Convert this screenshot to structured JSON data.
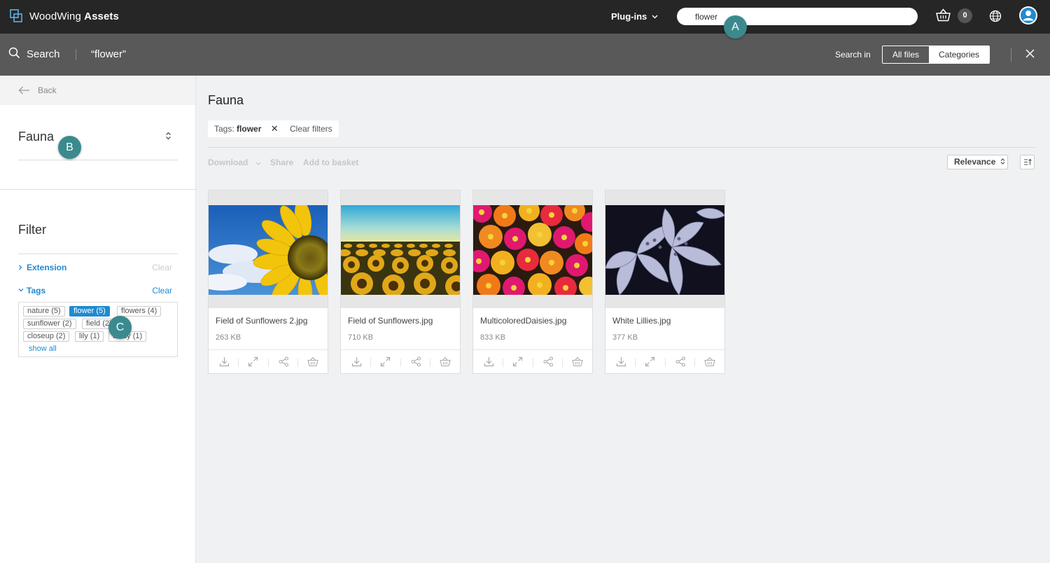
{
  "topbar": {
    "brand_light": "WoodWing",
    "brand_bold": "Assets",
    "plugins_label": "Plug-ins",
    "search_value": "flower",
    "basket_count": "0"
  },
  "searchbar": {
    "label": "Search",
    "query": "“flower”",
    "search_in_label": "Search in",
    "scope_all": "All files",
    "scope_categories": "Categories"
  },
  "sidebar": {
    "back_label": "Back",
    "category_title": "Fauna",
    "filter_title": "Filter",
    "facets": [
      {
        "name": "Extension",
        "clear": "Clear",
        "expanded": false
      },
      {
        "name": "Tags",
        "clear": "Clear",
        "expanded": true
      }
    ],
    "tags": [
      {
        "label": "nature  (5)",
        "selected": false
      },
      {
        "label": "flower  (5)",
        "selected": true
      },
      {
        "label": "flowers  (4)",
        "selected": false
      },
      {
        "label": "sunflower  (2)",
        "selected": false
      },
      {
        "label": "field  (2)",
        "selected": false
      },
      {
        "label": "closeup  (2)",
        "selected": false
      },
      {
        "label": "lily  (1)",
        "selected": false
      },
      {
        "label": "daisy  (1)",
        "selected": false
      }
    ],
    "show_all": "show all"
  },
  "main": {
    "title": "Fauna",
    "active_filter_prefix": "Tags:",
    "active_filter_value": "flower",
    "clear_filters": "Clear filters",
    "toolbar": {
      "download": "Download",
      "share": "Share",
      "add_to_basket": "Add to basket",
      "sort": "Relevance"
    },
    "assets": [
      {
        "name": "Field of Sunflowers 2.jpg",
        "size": "263 KB"
      },
      {
        "name": "Field of Sunflowers.jpg",
        "size": "710 KB"
      },
      {
        "name": "MulticoloredDaisies.jpg",
        "size": "833 KB"
      },
      {
        "name": "White Lillies.jpg",
        "size": "377 KB"
      }
    ]
  },
  "callouts": [
    "A",
    "B",
    "C"
  ],
  "colors": {
    "topbar": "#262626",
    "searchbar": "#595959",
    "accent": "#1f8ad1",
    "callout": "#3a8a8e"
  }
}
